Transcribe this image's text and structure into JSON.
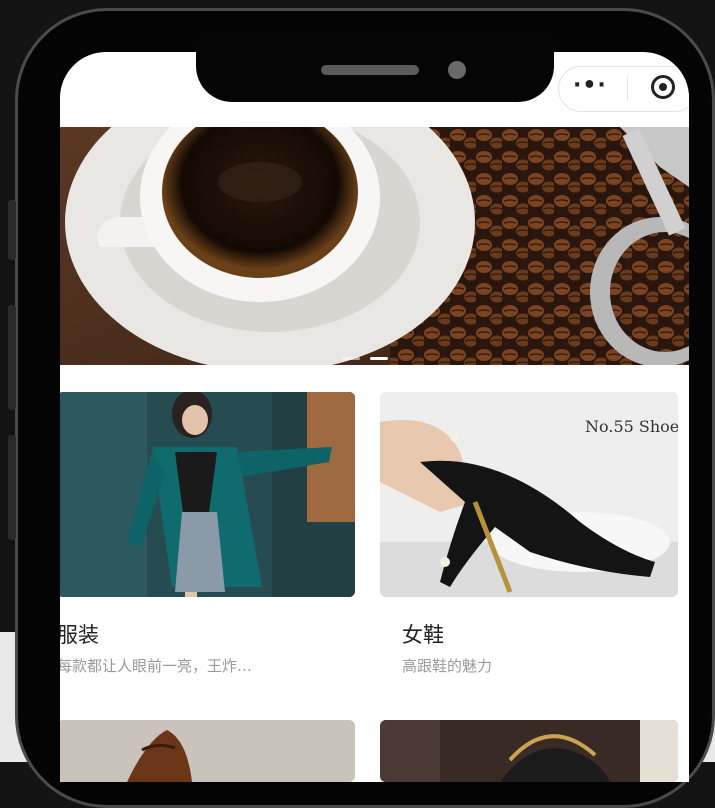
{
  "capsule": {
    "more_icon": "more-dots-icon",
    "close_icon": "target-circle-icon"
  },
  "banner": {
    "image": "coffee-cup-and-beans-photo",
    "indicator_count": 2,
    "active_index": 1
  },
  "products": [
    {
      "title": "服装",
      "subtitle": "每款都让人眼前一亮，王炸…",
      "image": "woman-teal-blazer-photo"
    },
    {
      "title": "女鞋",
      "subtitle": "高跟鞋的魅力",
      "image": "black-high-heel-photo",
      "image_text": "No.55 Shoe"
    }
  ],
  "next_row_images": [
    "brown-leather-shoe-photo",
    "black-handbag-photo"
  ]
}
